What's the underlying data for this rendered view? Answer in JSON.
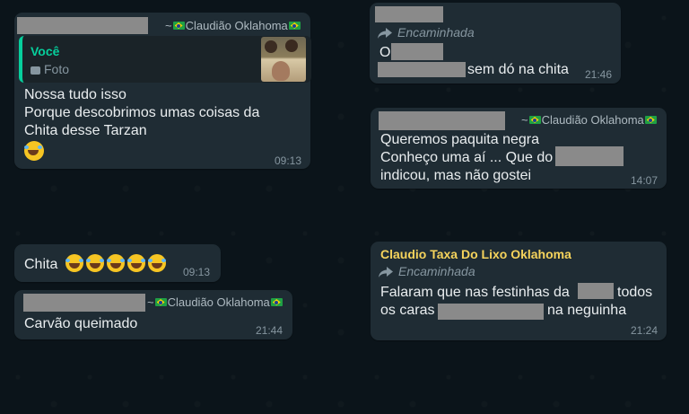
{
  "colors": {
    "background": "#0b141a",
    "bubble": "#1f2c34",
    "text": "#e9edef",
    "muted": "#8696a0",
    "quote_accent": "#06cf9c",
    "sender_gold": "#f5d35c"
  },
  "messages": {
    "m1": {
      "author": "~🇧🇷Claudião Oklahoma🇧🇷",
      "quote_author": "Você",
      "quote_type": "Foto",
      "lines": [
        "Nossa tudo isso",
        "Porque descobrimos umas coisas da",
        "Chita desse Tarzan"
      ],
      "time": "09:13"
    },
    "m2": {
      "text": "Chita",
      "time": "09:13"
    },
    "m3": {
      "author": "~🇧🇷Claudião Oklahoma🇧🇷",
      "text": "Carvão queimado",
      "time": "21:44"
    },
    "m4": {
      "forwarded": "Encaminhada",
      "line1": "O",
      "line2_suffix": "sem dó na chita",
      "time": "21:46"
    },
    "m5": {
      "author": "~🇧🇷Claudião Oklahoma🇧🇷",
      "line1": "Queremos paquita negra",
      "line2": "Conheço uma aí ... Que do",
      "line3": "indicou, mas não gostei",
      "time": "14:07"
    },
    "m6": {
      "sender": "Claudio Taxa Do Lixo Oklahoma",
      "forwarded": "Encaminhada",
      "line1_prefix": "Falaram que nas festinhas da",
      "line1_suffix": "todos",
      "line2_prefix": "os caras",
      "line2_suffix": "na neguinha",
      "time": "21:24"
    }
  }
}
